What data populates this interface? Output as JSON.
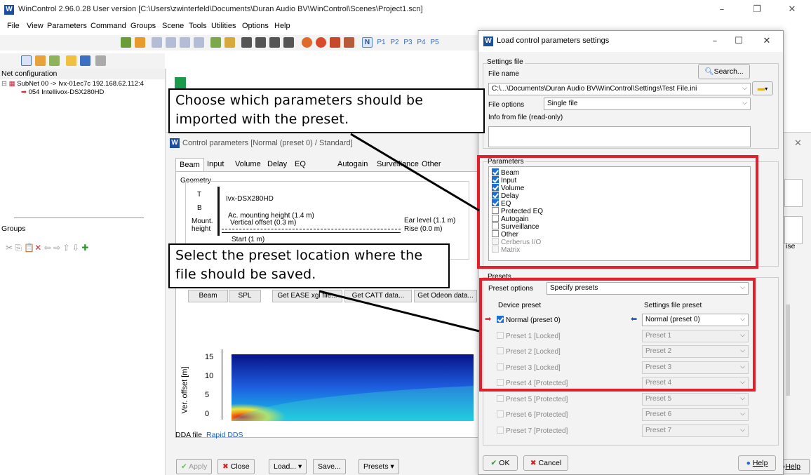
{
  "main_window": {
    "title": "WinControl 2.96.0.28 User version  [C:\\Users\\zwinterfeld\\Documents\\Duran Audio BV\\WinControl\\Scenes\\Project1.scn]",
    "menu": [
      "File",
      "View",
      "Parameters",
      "Command",
      "Groups",
      "Scene",
      "Tools",
      "Utilities",
      "Options",
      "Help"
    ],
    "toolbar_preset_labels": [
      "N",
      "P1",
      "P2",
      "P3",
      "P4",
      "P5"
    ],
    "net_config_header": "Net configuration",
    "tree": {
      "subnet": "SubNet 00 -> Ivx-01ec7c 192.168.62.112:4",
      "device": "054 Intellivox-DSX280HD"
    },
    "groups_header": "Groups"
  },
  "control_params": {
    "title": "Control parameters [Normal (preset 0) / Standard]",
    "tabs": [
      "Beam",
      "Input",
      "Volume",
      "Delay",
      "EQ",
      "Autogain",
      "Surveillance",
      "Other"
    ],
    "geometry_label": "Geometry",
    "t_label": "T",
    "b_label": "B",
    "device_label": "Ivx-DSX280HD",
    "mount_label": "Mount. height",
    "ac_mounting": "Ac. mounting height (1.4 m)",
    "vertical_offset": "Vertical offset (0.3 m)",
    "ear_level": "Ear level (1.1 m)",
    "rise": "Rise (0.0 m)",
    "start": "Start (1 m)",
    "buttons_row": [
      "Beam",
      "SPL",
      "Get EASE xgl file...",
      "Get CATT data...",
      "Get Odeon data..."
    ],
    "y_axis_label": "Ver. offset [m]",
    "y_ticks": [
      "15",
      "10",
      "5",
      "0"
    ],
    "dda_label": "DDA file",
    "dda_value": "Rapid DDS",
    "right_clipped": "ise",
    "bottom_buttons": {
      "apply": "Apply",
      "close": "Close",
      "load": "Load...",
      "save": "Save...",
      "presets": "Presets",
      "help": "Help"
    }
  },
  "dialog": {
    "title": "Load control parameters settings",
    "settings_file_group": "Settings file",
    "file_name_label": "File name",
    "search_button": "Search...",
    "file_name_value": "C:\\...\\Documents\\Duran Audio BV\\WinControl\\Settings\\Test File.ini",
    "file_options_label": "File options",
    "file_options_value": "Single file",
    "info_label": "Info from file (read-only)",
    "parameters_group": "Parameters",
    "parameters": [
      {
        "label": "Beam",
        "checked": true,
        "enabled": true
      },
      {
        "label": "Input",
        "checked": true,
        "enabled": true
      },
      {
        "label": "Volume",
        "checked": true,
        "enabled": true
      },
      {
        "label": "Delay",
        "checked": true,
        "enabled": true
      },
      {
        "label": "EQ",
        "checked": true,
        "enabled": true
      },
      {
        "label": "Protected EQ",
        "checked": false,
        "enabled": true
      },
      {
        "label": "Autogain",
        "checked": false,
        "enabled": true
      },
      {
        "label": "Surveillance",
        "checked": false,
        "enabled": true
      },
      {
        "label": "Other",
        "checked": false,
        "enabled": true
      },
      {
        "label": "Cerberus I/O",
        "checked": false,
        "enabled": false
      },
      {
        "label": "Matrix",
        "checked": false,
        "enabled": false
      }
    ],
    "presets_group": "Presets",
    "preset_options_label": "Preset options",
    "preset_options_value": "Specify presets",
    "device_preset_header": "Device preset",
    "settings_file_preset_header": "Settings file preset",
    "presets": [
      {
        "device": "Normal (preset 0)",
        "checked": true,
        "enabled": true,
        "file": "Normal (preset 0)"
      },
      {
        "device": "Preset 1 [Locked]",
        "checked": false,
        "enabled": false,
        "file": "Preset 1"
      },
      {
        "device": "Preset 2 [Locked]",
        "checked": false,
        "enabled": false,
        "file": "Preset 2"
      },
      {
        "device": "Preset 3 [Locked]",
        "checked": false,
        "enabled": false,
        "file": "Preset 3"
      },
      {
        "device": "Preset 4 [Protected]",
        "checked": false,
        "enabled": false,
        "file": "Preset 4"
      },
      {
        "device": "Preset 5 [Protected]",
        "checked": false,
        "enabled": false,
        "file": "Preset 5"
      },
      {
        "device": "Preset 6 [Protected]",
        "checked": false,
        "enabled": false,
        "file": "Preset 6"
      },
      {
        "device": "Preset 7 [Protected]",
        "checked": false,
        "enabled": false,
        "file": "Preset 7"
      }
    ],
    "ok_button": "OK",
    "cancel_button": "Cancel",
    "help_button": "Help"
  },
  "callouts": {
    "top": "Choose which parameters should be imported with the preset.",
    "bottom": "Select the preset location where the file should be saved."
  },
  "colors": {
    "highlight_red": "#e2202d",
    "check_blue": "#1e6fd0",
    "link_blue": "#1a5fb4"
  }
}
